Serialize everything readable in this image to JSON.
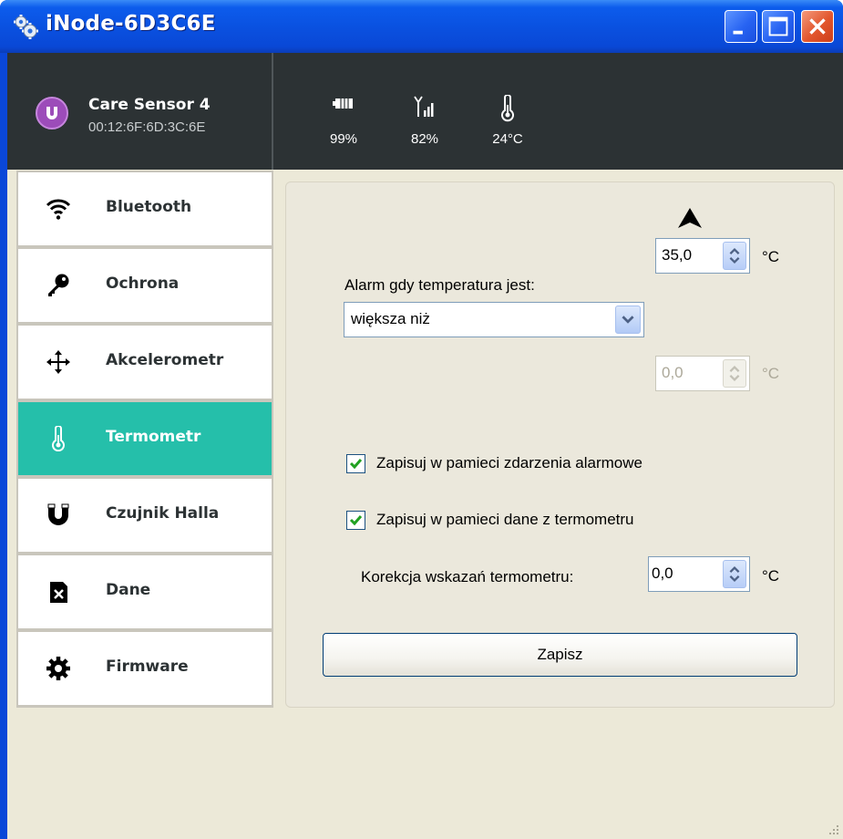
{
  "window": {
    "title": "iNode-6D3C6E",
    "icon": "gears-icon",
    "controls": [
      "minimize",
      "maximize",
      "close"
    ]
  },
  "device": {
    "name": "Care Sensor 4",
    "mac": "00:12:6F:6D:3C:6E",
    "avatar_icon": "magnet-icon",
    "stats": {
      "battery": "99%",
      "signal": "82%",
      "temperature": "24°C"
    }
  },
  "sidebar": {
    "items": [
      {
        "label": "Bluetooth",
        "icon": "wifi-icon",
        "active": false
      },
      {
        "label": "Ochrona",
        "icon": "key-icon",
        "active": false
      },
      {
        "label": "Akcelerometr",
        "icon": "move-arrows-icon",
        "active": false
      },
      {
        "label": "Termometr",
        "icon": "thermometer-icon",
        "active": true
      },
      {
        "label": "Czujnik Halla",
        "icon": "magnet-icon",
        "active": false
      },
      {
        "label": "Dane",
        "icon": "sd-card-icon",
        "active": false
      },
      {
        "label": "Firmware",
        "icon": "gear-icon",
        "active": false
      }
    ]
  },
  "thermometer": {
    "upper_value": "35,0",
    "upper_unit": "°C",
    "alarm_label": "Alarm gdy temperatura jest:",
    "alarm_condition": "większa niż",
    "lower_value": "0,0",
    "lower_unit": "°C",
    "log_alarms_label": "Zapisuj w pamieci zdarzenia alarmowe",
    "log_alarms_checked": true,
    "log_data_label": "Zapisuj w pamieci dane z termometru",
    "log_data_checked": true,
    "correction_label": "Korekcja wskazań  termometru:",
    "correction_value": "0,0",
    "correction_unit": "°C",
    "save_label": "Zapisz"
  },
  "colors": {
    "titlebar": "#0A50DF",
    "header": "#2C3234",
    "accent": "#25BFAA",
    "background": "#ECE9D8"
  }
}
